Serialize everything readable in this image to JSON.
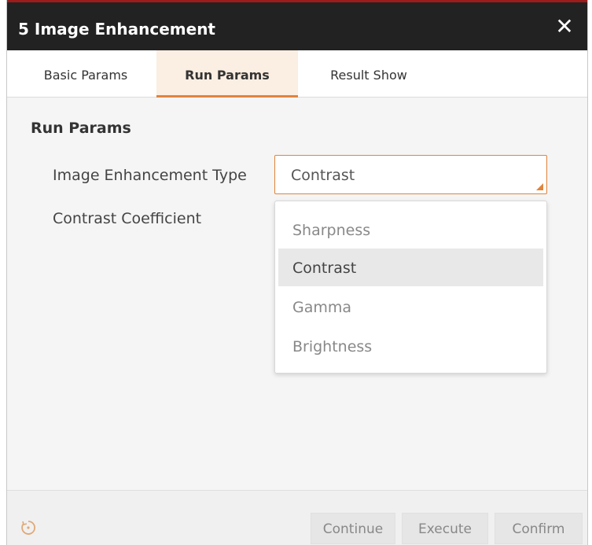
{
  "window": {
    "title": "5 Image Enhancement",
    "close_label": "✕"
  },
  "tabs": [
    {
      "label": "Basic Params",
      "active": false
    },
    {
      "label": "Run Params",
      "active": true
    },
    {
      "label": "Result Show",
      "active": false
    }
  ],
  "section": {
    "title": "Run Params"
  },
  "fields": {
    "type_label": "Image Enhancement Type",
    "type_value": "Contrast",
    "coef_label": "Contrast Coefficient"
  },
  "dropdown": {
    "options": [
      "Sharpness",
      "Contrast",
      "Gamma",
      "Brightness"
    ],
    "highlighted": "Contrast"
  },
  "footer": {
    "buttons": [
      "Continue",
      "Execute",
      "Confirm"
    ],
    "left_icon": "reload-icon"
  },
  "colors": {
    "accent": "#e0843c",
    "titlebar": "#222222",
    "titlebar_top": "#9e1b1b"
  }
}
